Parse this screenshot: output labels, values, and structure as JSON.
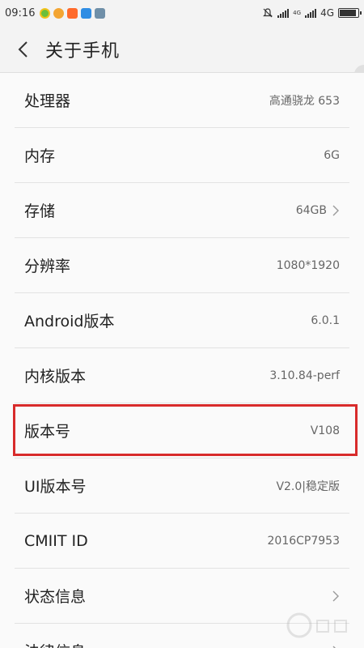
{
  "status_bar": {
    "time": "09:16",
    "network_label": "4G",
    "signal_small_1": "4G",
    "signal_small_2": "4G"
  },
  "header": {
    "title": "关于手机"
  },
  "settings": [
    {
      "label": "处理器",
      "value": "高通骁龙 653",
      "chevron": false
    },
    {
      "label": "内存",
      "value": "6G",
      "chevron": false
    },
    {
      "label": "存储",
      "value": "64GB",
      "chevron": true
    },
    {
      "label": "分辨率",
      "value": "1080*1920",
      "chevron": false
    },
    {
      "label": "Android版本",
      "value": "6.0.1",
      "chevron": false
    },
    {
      "label": "内核版本",
      "value": "3.10.84-perf",
      "chevron": false
    },
    {
      "label": "版本号",
      "value": "V108",
      "chevron": false,
      "highlighted": true
    },
    {
      "label": "UI版本号",
      "value": "V2.0|稳定版",
      "chevron": false
    },
    {
      "label": "CMIIT ID",
      "value": "2016CP7953",
      "chevron": false
    },
    {
      "label": "状态信息",
      "value": "",
      "chevron": true
    },
    {
      "label": "法律信息",
      "value": "",
      "chevron": true
    }
  ],
  "colors": {
    "highlight": "#d82b2b",
    "background": "#f3f3f3"
  }
}
